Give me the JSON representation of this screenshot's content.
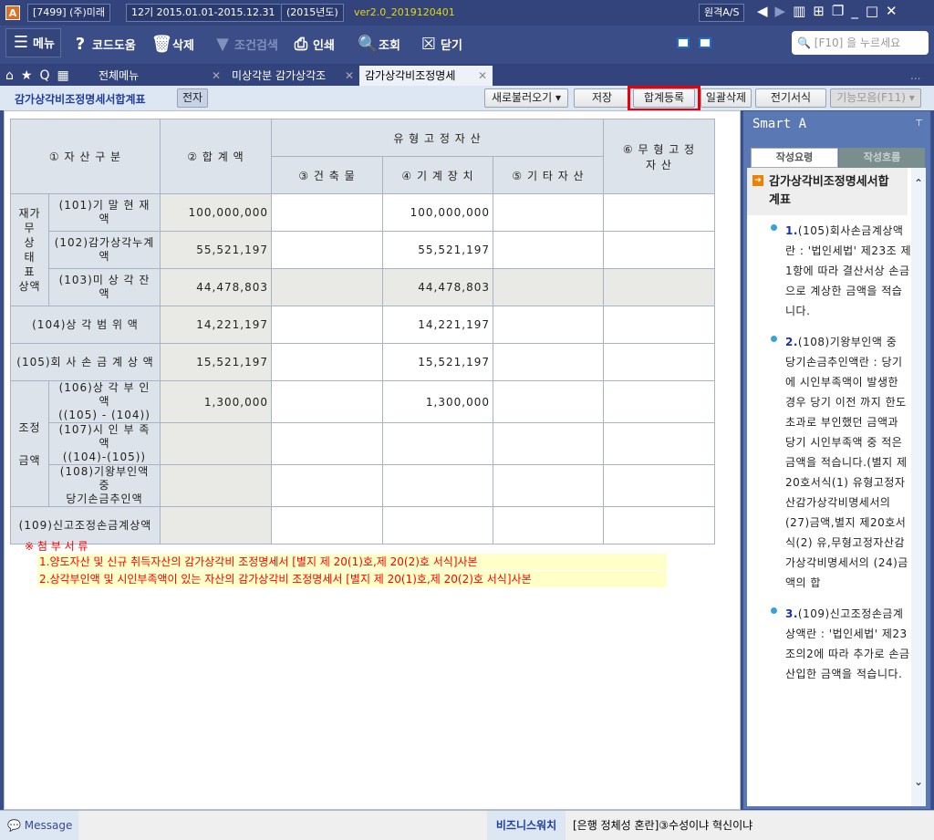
{
  "titlebar": {
    "app_icon": "A",
    "company": "[7499] (주)미래",
    "period": "12기 2015.01.01-2015.12.31",
    "year": "(2015년도)",
    "version": "ver2.0_2019120401",
    "remote": "원격A/S"
  },
  "toolbar": {
    "menu": "메뉴",
    "code_help": "코드도움",
    "delete": "삭제",
    "filter": "조건검색",
    "print": "인쇄",
    "lookup": "조회",
    "close": "닫기",
    "search_placeholder": "[F10] 을 누르세요"
  },
  "tabs": {
    "all_menu": "전체메뉴",
    "tab1": "미상각분 감가상각조",
    "tab2": "감가상각비조정명세",
    "more": "..."
  },
  "subheader": {
    "title": "감가상각비조정명세서합계표",
    "badge": "전자",
    "buttons": [
      "새로불러오기",
      "저장",
      "합계등록",
      "일괄삭제",
      "전기서식",
      "기능모음(F11)"
    ]
  },
  "table": {
    "headers": {
      "asset_class": "① 자 산 구 분",
      "total": "② 합 계 액",
      "tangible": "유 형 고 정 자 산",
      "building": "③ 건 축 물",
      "machine": "④ 기 계 장 치",
      "other": "⑤ 기 타 자 산",
      "intangible": "⑥ 무 형 고 정 자 산"
    },
    "group1_lines": [
      "재가",
      "무",
      "상",
      "태",
      "표",
      "상액"
    ],
    "group2_lines": [
      "조정",
      "금액"
    ],
    "rows": [
      {
        "label": "(101)기 말 현 재 액",
        "total": "100,000,000",
        "building": "",
        "machine": "100,000,000",
        "other": "",
        "intangible": ""
      },
      {
        "label": "(102)감가상각누계액",
        "total": "55,521,197",
        "building": "",
        "machine": "55,521,197",
        "other": "",
        "intangible": ""
      },
      {
        "label": "(103)미 상 각 잔 액",
        "total": "44,478,803",
        "building": "",
        "machine": "44,478,803",
        "other": "",
        "intangible": ""
      },
      {
        "label": "(104)상 각  범 위 액",
        "total": "14,221,197",
        "building": "",
        "machine": "14,221,197",
        "other": "",
        "intangible": ""
      },
      {
        "label": "(105)회 사 손 금 계 상 액",
        "total": "15,521,197",
        "building": "",
        "machine": "15,521,197",
        "other": "",
        "intangible": ""
      },
      {
        "label": "(106)상 각 부 인 액",
        "label2": "((105) - (104))",
        "total": "1,300,000",
        "building": "",
        "machine": "1,300,000",
        "other": "",
        "intangible": ""
      },
      {
        "label": "(107)시 인 부 족 액",
        "label2": "((104)-(105))",
        "total": "",
        "building": "",
        "machine": "",
        "other": "",
        "intangible": ""
      },
      {
        "label": "(108)기왕부인액 중",
        "label2": "당기손금추인액",
        "total": "",
        "building": "",
        "machine": "",
        "other": "",
        "intangible": ""
      },
      {
        "label": "(109)신고조정손금계상액",
        "total": "",
        "building": "",
        "machine": "",
        "other": "",
        "intangible": ""
      }
    ]
  },
  "attachments": {
    "title": "※ 첨 부 서 류",
    "items": [
      "1.양도자산 및 신규 취득자산의 감가상각비 조정명세서 [별지 제 20(1)호,제 20(2)호 서식]사본",
      "2.상각부인액 및 시인부족액이 있는 자산의 감가상각비 조정명세서 [별지 제 20(1)호,제 20(2)호 서식]사본"
    ]
  },
  "smart": {
    "title": "Smart A",
    "tab_active": "작성요령",
    "tab_other": "작성흐름",
    "heading": "감가상각비조정명세서합계표",
    "items": [
      {
        "num": "1.",
        "text": "(105)회사손금계상액란 : '법인세법' 제23조 제1항에 따라 결산서상 손금으로 계상한 금액을 적습니다."
      },
      {
        "num": "2.",
        "text": "(108)기왕부인액 중 당기손금추인액란 : 당기에 시인부족액이 발생한 경우 당기 이전 까지 한도초과로 부인했던 금액과 당기 시인부족액 중 적은 금액을 적습니다.(별지 제 20호서식(1) 유형고정자산감가상각비명세서의 (27)금액,별지 제20호서식(2) 유,무형고정자산감가상각비명세서의 (24)금액의 합"
      },
      {
        "num": "3.",
        "text": "(109)신고조정손금계상액란 : '법인세법' 제23조의2에 따라 추가로 손금산입한 금액을 적습니다."
      }
    ]
  },
  "status": {
    "message": "Message",
    "watch_label": "비즈니스워치",
    "news": "[은행 정체성 혼란]③수성이냐 혁신이냐"
  }
}
